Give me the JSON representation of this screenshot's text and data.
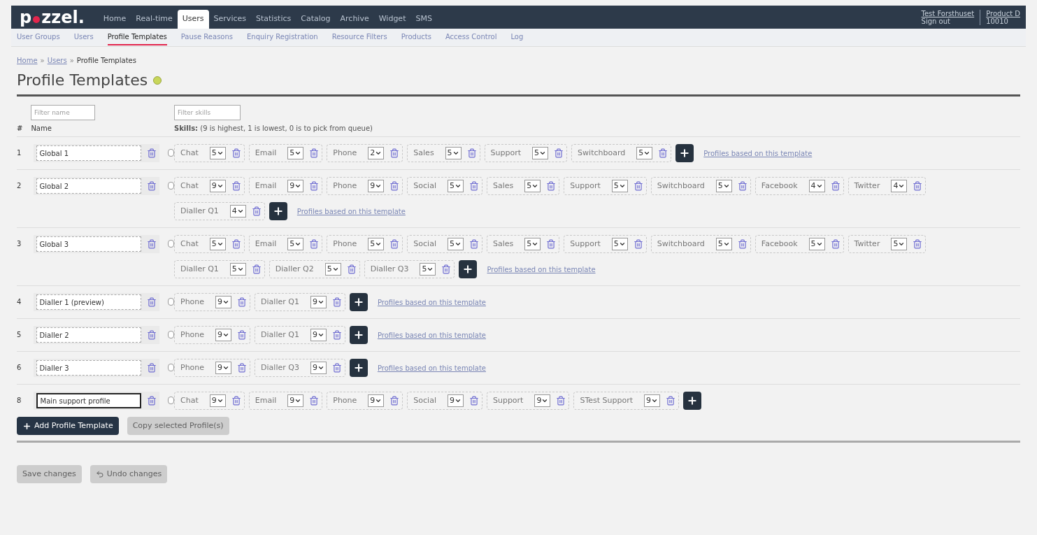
{
  "brand": {
    "logo_start": "p",
    "logo_end": "zzel."
  },
  "main_nav": [
    {
      "label": "Home",
      "selected": false
    },
    {
      "label": "Real-time",
      "selected": false
    },
    {
      "label": "Users",
      "selected": true
    },
    {
      "label": "Services",
      "selected": false
    },
    {
      "label": "Statistics",
      "selected": false
    },
    {
      "label": "Catalog",
      "selected": false
    },
    {
      "label": "Archive",
      "selected": false
    },
    {
      "label": "Widget",
      "selected": false
    },
    {
      "label": "SMS",
      "selected": false
    }
  ],
  "user_menu": [
    {
      "title": "Test Forsthuset",
      "subtitle": "Sign out"
    },
    {
      "title": "Product D",
      "subtitle": "10010"
    }
  ],
  "sub_nav": [
    {
      "label": "User Groups",
      "selected": false
    },
    {
      "label": "Users",
      "selected": false
    },
    {
      "label": "Profile Templates",
      "selected": true
    },
    {
      "label": "Pause Reasons",
      "selected": false
    },
    {
      "label": "Enquiry Registration",
      "selected": false
    },
    {
      "label": "Resource Filters",
      "selected": false
    },
    {
      "label": "Products",
      "selected": false
    },
    {
      "label": "Access Control",
      "selected": false
    },
    {
      "label": "Log",
      "selected": false
    }
  ],
  "breadcrumb": [
    {
      "label": "Home",
      "link": true
    },
    {
      "label": "Users",
      "link": true
    },
    {
      "label": "Profile Templates",
      "link": false
    }
  ],
  "breadcrumb_separator": "»",
  "page_title": "Profile Templates",
  "filters": {
    "name_placeholder": "Filter name",
    "skills_placeholder": "Filter skills"
  },
  "columns": {
    "number": "#",
    "name": "Name",
    "skills_label": "Skills:",
    "skills_hint": "(9 is highest, 1 is lowest, 0 is to pick from queue)"
  },
  "templates": [
    {
      "number": "1",
      "name": "Global 1",
      "focused": false,
      "checked": false,
      "link": "Profiles based on this template",
      "skills": [
        {
          "name": "Chat",
          "value": "5"
        },
        {
          "name": "Email",
          "value": "5"
        },
        {
          "name": "Phone",
          "value": "2"
        },
        {
          "name": "Sales",
          "value": "5"
        },
        {
          "name": "Support",
          "value": "5"
        },
        {
          "name": "Switchboard",
          "value": "5"
        }
      ]
    },
    {
      "number": "2",
      "name": "Global 2",
      "focused": false,
      "checked": false,
      "link": "Profiles based on this template",
      "skills": [
        {
          "name": "Chat",
          "value": "9"
        },
        {
          "name": "Email",
          "value": "9"
        },
        {
          "name": "Phone",
          "value": "9"
        },
        {
          "name": "Social",
          "value": "5"
        },
        {
          "name": "Sales",
          "value": "5"
        },
        {
          "name": "Support",
          "value": "5"
        },
        {
          "name": "Switchboard",
          "value": "5"
        },
        {
          "name": "Facebook",
          "value": "4"
        },
        {
          "name": "Twitter",
          "value": "4"
        },
        {
          "name": "Dialler Q1",
          "value": "4"
        }
      ]
    },
    {
      "number": "3",
      "name": "Global 3",
      "focused": false,
      "checked": false,
      "link": "Profiles based on this template",
      "skills": [
        {
          "name": "Chat",
          "value": "5"
        },
        {
          "name": "Email",
          "value": "5"
        },
        {
          "name": "Phone",
          "value": "5"
        },
        {
          "name": "Social",
          "value": "5"
        },
        {
          "name": "Sales",
          "value": "5"
        },
        {
          "name": "Support",
          "value": "5"
        },
        {
          "name": "Switchboard",
          "value": "5"
        },
        {
          "name": "Facebook",
          "value": "5"
        },
        {
          "name": "Twitter",
          "value": "5"
        },
        {
          "name": "Dialler Q1",
          "value": "5"
        },
        {
          "name": "Dialler Q2",
          "value": "5"
        },
        {
          "name": "Dialler Q3",
          "value": "5"
        }
      ]
    },
    {
      "number": "4",
      "name": "Dialler 1 (preview)",
      "focused": false,
      "checked": false,
      "link": "Profiles based on this template",
      "skills": [
        {
          "name": "Phone",
          "value": "9"
        },
        {
          "name": "Dialler Q1",
          "value": "9"
        }
      ]
    },
    {
      "number": "5",
      "name": "Dialler 2",
      "focused": false,
      "checked": false,
      "link": "Profiles based on this template",
      "skills": [
        {
          "name": "Phone",
          "value": "9"
        },
        {
          "name": "Dialler Q1",
          "value": "9"
        }
      ]
    },
    {
      "number": "6",
      "name": "Dialler 3",
      "focused": false,
      "checked": false,
      "link": "Profiles based on this template",
      "skills": [
        {
          "name": "Phone",
          "value": "9"
        },
        {
          "name": "Dialler Q3",
          "value": "9"
        }
      ]
    },
    {
      "number": "8",
      "name": "Main support profile",
      "focused": true,
      "checked": false,
      "skills": [
        {
          "name": "Chat",
          "value": "9"
        },
        {
          "name": "Email",
          "value": "9"
        },
        {
          "name": "Phone",
          "value": "9"
        },
        {
          "name": "Social",
          "value": "9"
        },
        {
          "name": "Support",
          "value": "9"
        },
        {
          "name": "STest Support",
          "value": "9"
        }
      ]
    }
  ],
  "actions": [
    {
      "label": "Add Profile Template",
      "disabled": false,
      "kind": "add"
    },
    {
      "label": "Copy selected Profile(s)",
      "disabled": true,
      "kind": "plain"
    }
  ],
  "footer_actions": [
    {
      "label": "Save changes",
      "disabled": true,
      "kind": "plain"
    },
    {
      "label": "Undo changes",
      "disabled": true,
      "kind": "undo"
    }
  ]
}
